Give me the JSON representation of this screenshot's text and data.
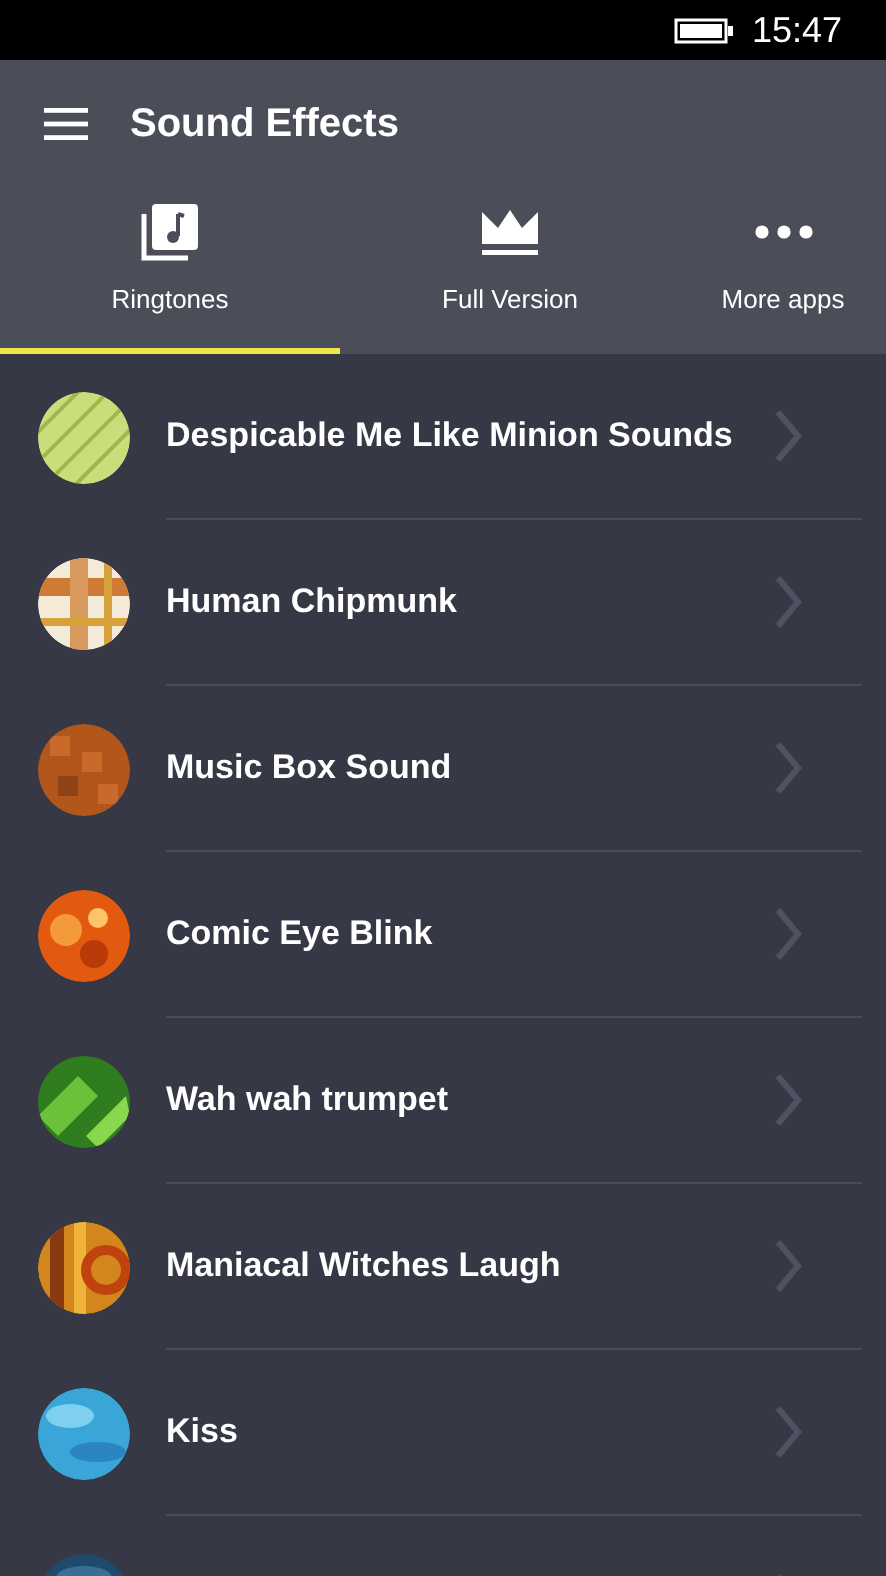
{
  "status_bar": {
    "time": "15:47"
  },
  "header": {
    "title": "Sound Effects"
  },
  "tabs": [
    {
      "label": "Ringtones",
      "kind": "music",
      "selected": true
    },
    {
      "label": "Full Version",
      "kind": "crown",
      "selected": false
    },
    {
      "label": "More apps",
      "kind": "dots",
      "selected": false
    }
  ],
  "items": [
    {
      "title": "Despicable Me Like Minion Sounds",
      "thumbnail": {
        "kind": "picture"
      }
    },
    {
      "title": "Human Chipmunk",
      "thumbnail": {
        "kind": "picture"
      }
    },
    {
      "title": "Music Box Sound",
      "thumbnail": {
        "kind": "picture"
      }
    },
    {
      "title": "Comic Eye Blink",
      "thumbnail": {
        "kind": "picture"
      }
    },
    {
      "title": "Wah wah trumpet",
      "thumbnail": {
        "kind": "picture"
      }
    },
    {
      "title": "Maniacal Witches Laugh",
      "thumbnail": {
        "kind": "picture"
      }
    },
    {
      "title": "Kiss",
      "thumbnail": {
        "kind": "picture"
      }
    },
    {
      "thumbnail": {
        "kind": "picture"
      }
    }
  ]
}
